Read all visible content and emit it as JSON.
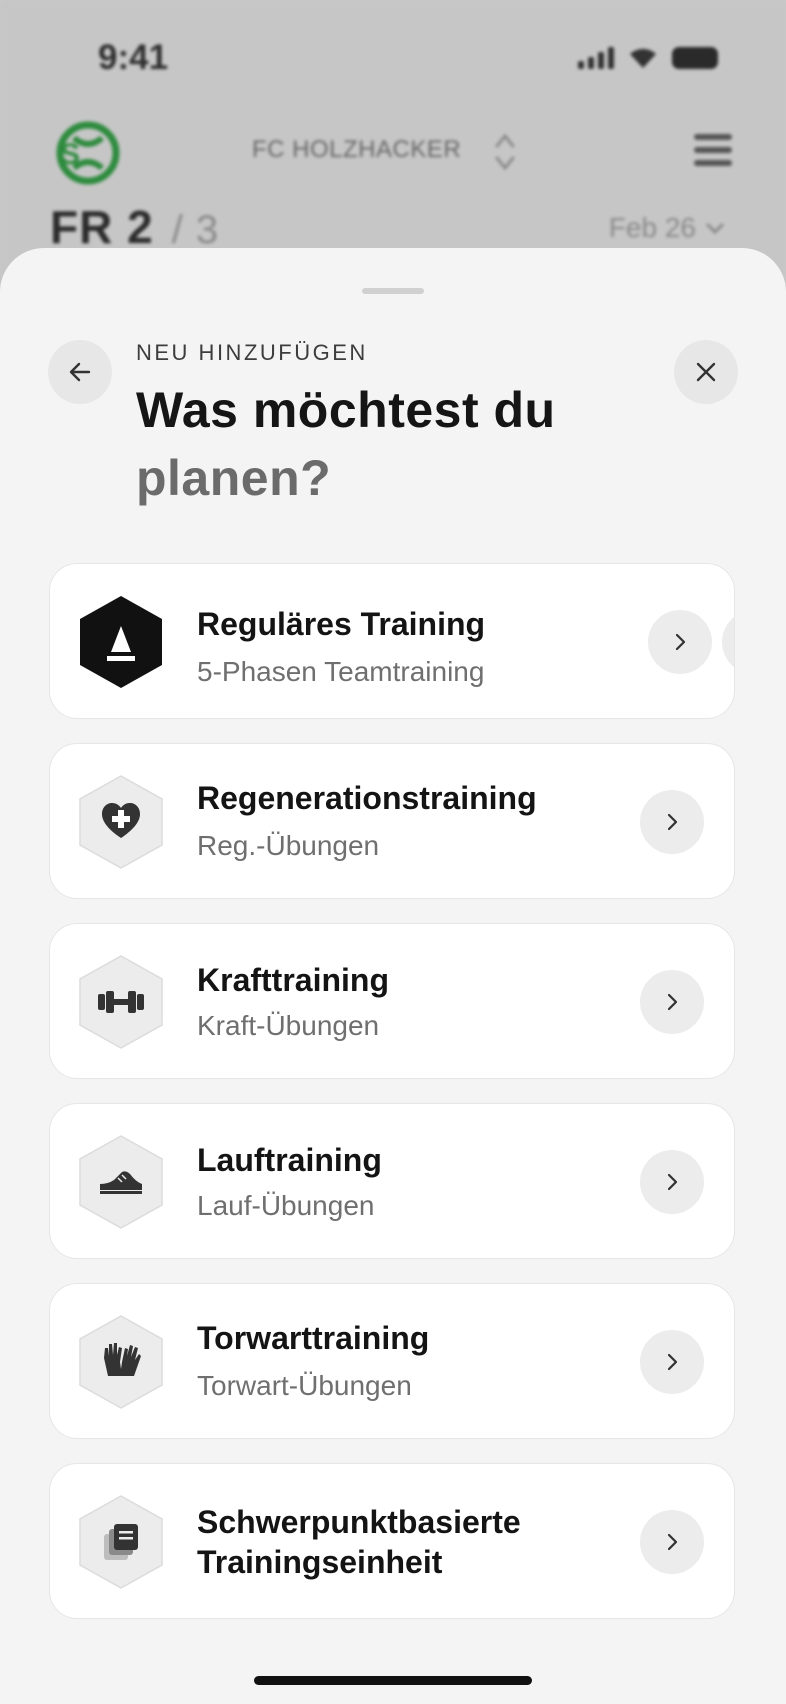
{
  "status_bar": {
    "time": "9:41"
  },
  "app_header": {
    "club_name": "FC HOLZHACKER",
    "week_label": "FR 2",
    "week_total": "/ 3",
    "date": "Feb 26"
  },
  "sheet": {
    "eyebrow": "NEU HINZUFÜGEN",
    "headline_line1": "Was möchtest du",
    "headline_line2": "planen?",
    "options": [
      {
        "title": "Reguläres Training",
        "subtitle": "5-Phasen Teamtraining",
        "icon": "cone-icon"
      },
      {
        "title": "Regenerationstraining",
        "subtitle": "Reg.-Übungen",
        "icon": "heart-plus-icon"
      },
      {
        "title": "Krafttraining",
        "subtitle": "Kraft-Übungen",
        "icon": "dumbbell-icon"
      },
      {
        "title": "Lauftraining",
        "subtitle": "Lauf-Übungen",
        "icon": "running-shoe-icon"
      },
      {
        "title": "Torwarttraining",
        "subtitle": "Torwart-Übungen",
        "icon": "goalkeeper-gloves-icon"
      },
      {
        "title_line1": "Schwerpunktbasierte",
        "title_line2": "Trainingseinheit",
        "icon": "documents-icon"
      }
    ]
  },
  "colors": {
    "sheet_bg": "#f4f4f4",
    "card_bg": "#ffffff",
    "icon_active": "#111111",
    "icon_inactive": "#ececec",
    "club_green": "#2e8b3e"
  }
}
